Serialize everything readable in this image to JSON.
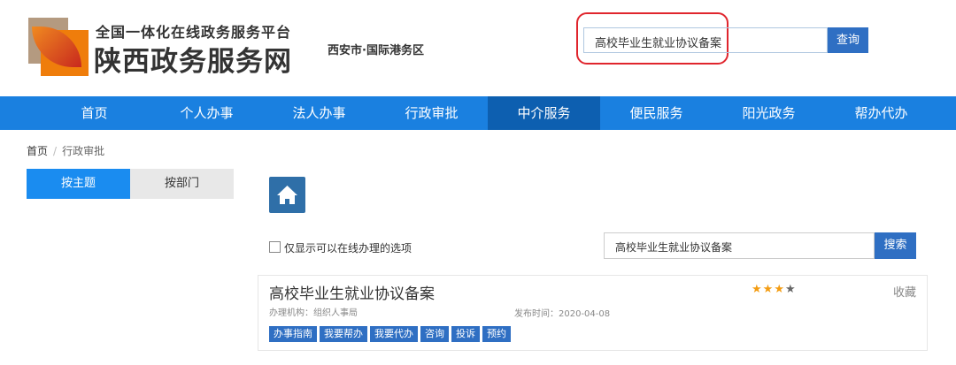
{
  "header": {
    "tagline": "全国一体化在线政务服务平台",
    "site_name": "陕西政务服务网",
    "region": "西安市·国际港务区",
    "search_value": "高校毕业生就业协议备案",
    "search_button": "查询"
  },
  "nav": [
    "首页",
    "个人办事",
    "法人办事",
    "行政审批",
    "中介服务",
    "便民服务",
    "阳光政务",
    "帮办代办"
  ],
  "nav_active": "中介服务",
  "breadcrumb": {
    "home": "首页",
    "current": "行政审批"
  },
  "tabs": {
    "by_topic": "按主题",
    "by_dept": "按部门"
  },
  "filter": {
    "online_only": "仅显示可以在线办理的选项",
    "search_value": "高校毕业生就业协议备案",
    "search_button": "搜索"
  },
  "result": {
    "title": "高校毕业生就业协议备案",
    "org": "办理机构：组织人事局",
    "date": "发布时间：2020-04-08",
    "rating": 3,
    "rating_max": 4,
    "favorite": "收藏",
    "actions": [
      "办事指南",
      "我要帮办",
      "我要代办",
      "咨询",
      "投诉",
      "预约"
    ]
  },
  "colors": {
    "nav": "#1a80e0",
    "accent": "#2f6fc3",
    "star": "#f39c12"
  }
}
